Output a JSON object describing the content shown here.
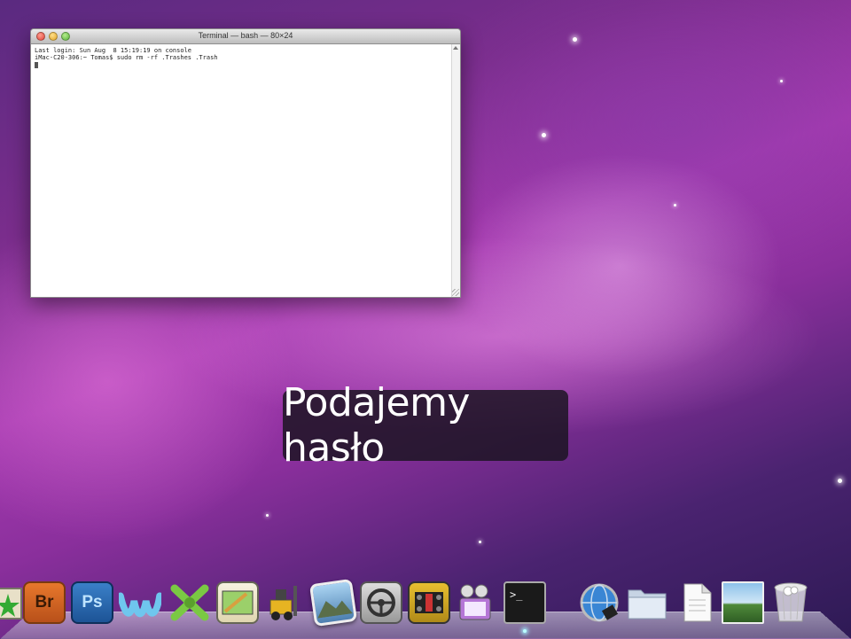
{
  "terminal": {
    "title": "Terminal — bash — 80×24",
    "lines": [
      "Last login: Sun Aug  8 15:19:19 on console",
      "iMac-C20-306:~ Tomas$ sudo rm -rf .Trashes .Trash"
    ]
  },
  "caption": "Podajemy hasło",
  "dock": {
    "items": [
      {
        "name": "Mail",
        "icon": "stamp-icon"
      },
      {
        "name": "Bridge",
        "label": "Br",
        "icon": "bridge-icon",
        "color": "#d9661f"
      },
      {
        "name": "Photoshop",
        "label": "Ps",
        "icon": "photoshop-icon",
        "color": "#2a6fb8"
      },
      {
        "name": "Wave app",
        "icon": "wave-icon"
      },
      {
        "name": "X app",
        "icon": "x-figure-icon"
      },
      {
        "name": "Preview",
        "icon": "preview-icon"
      },
      {
        "name": "Automator",
        "icon": "forklift-icon"
      },
      {
        "name": "Photo",
        "icon": "photo-icon"
      },
      {
        "name": "Steering",
        "icon": "steering-wheel-icon"
      },
      {
        "name": "Racing",
        "icon": "racecar-icon"
      },
      {
        "name": "iMovie",
        "icon": "imovie-icon"
      },
      {
        "name": "Terminal",
        "icon": "terminal-icon"
      },
      {
        "name": "Finder Globe",
        "icon": "globe-icon"
      },
      {
        "name": "Folder",
        "icon": "folder-icon"
      },
      {
        "name": "Document",
        "icon": "document-icon"
      },
      {
        "name": "Picture",
        "icon": "landscape-icon"
      },
      {
        "name": "Trash",
        "icon": "trash-icon"
      }
    ]
  }
}
